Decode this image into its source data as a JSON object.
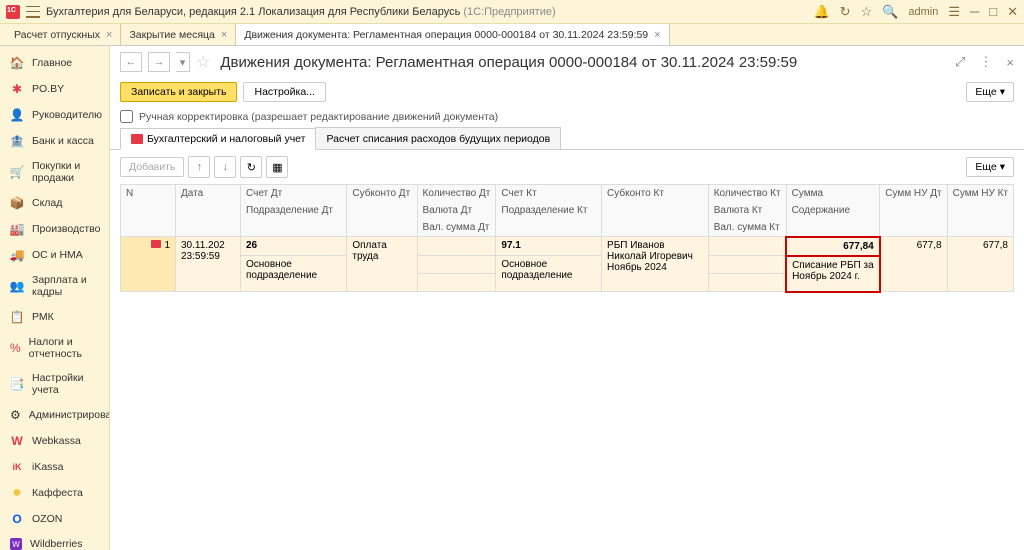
{
  "titlebar": {
    "app_name": "Бухгалтерия для Беларуси, редакция 2.1  Локализация для Республики Беларусь",
    "platform": "(1С:Предприятие)",
    "user": "admin"
  },
  "tabs": [
    {
      "label": "Расчет отпускных"
    },
    {
      "label": "Закрытие месяца"
    },
    {
      "label": "Движения документа: Регламентная операция 0000-000184 от 30.11.2024 23:59:59"
    }
  ],
  "sidebar": {
    "items": [
      {
        "icon": "🏠",
        "label": "Главное",
        "color": "#4a90e2"
      },
      {
        "icon": "✱",
        "label": "PO.BY",
        "color": "#e63946"
      },
      {
        "icon": "👤",
        "label": "Руководителю",
        "color": "#555"
      },
      {
        "icon": "🏦",
        "label": "Банк и касса",
        "color": "#555"
      },
      {
        "icon": "🛒",
        "label": "Покупки и продажи",
        "color": "#555"
      },
      {
        "icon": "📦",
        "label": "Склад",
        "color": "#555"
      },
      {
        "icon": "🏭",
        "label": "Производство",
        "color": "#555"
      },
      {
        "icon": "🚚",
        "label": "ОС и НМА",
        "color": "#555"
      },
      {
        "icon": "👥",
        "label": "Зарплата и кадры",
        "color": "#555"
      },
      {
        "icon": "📋",
        "label": "РМК",
        "color": "#555"
      },
      {
        "icon": "%",
        "label": "Налоги и отчетность",
        "color": "#e63946"
      },
      {
        "icon": "📑",
        "label": "Настройки учета",
        "color": "#555"
      },
      {
        "icon": "⚙",
        "label": "Администрирование",
        "color": "#555"
      },
      {
        "icon": "W",
        "label": "Webkassa",
        "color": "#e63946"
      },
      {
        "icon": "iK",
        "label": "iKassa",
        "color": "#e63946"
      },
      {
        "icon": "●",
        "label": "Каффеста",
        "color": "#f4c542"
      },
      {
        "icon": "O",
        "label": "OZON",
        "color": "#005bff"
      },
      {
        "icon": "W",
        "label": "Wildberries",
        "color": "#7b2cbf"
      }
    ]
  },
  "document": {
    "title": "Движения документа: Регламентная операция 0000-000184 от 30.11.2024 23:59:59",
    "save_close": "Записать и закрыть",
    "settings": "Настройка...",
    "more": "Еще",
    "manual_correction": "Ручная корректировка (разрешает редактирование движений документа)"
  },
  "inner_tabs": [
    {
      "label": "Бухгалтерский и налоговый учет"
    },
    {
      "label": "Расчет списания расходов будущих периодов"
    }
  ],
  "table_toolbar": {
    "add": "Добавить",
    "more": "Еще"
  },
  "table": {
    "headers": {
      "n": "N",
      "date": "Дата",
      "account_dt": "Счет Дт",
      "subconto_dt": "Субконто Дт",
      "qty_dt": "Количество Дт",
      "account_kt": "Счет Кт",
      "subconto_kt": "Субконто Кт",
      "qty_kt": "Количество Кт",
      "sum": "Сумма",
      "sum_nu_dt": "Сумм НУ Дт",
      "sum_nu_kt": "Сумм НУ Кт",
      "division_dt": "Подразделение Дт",
      "currency_dt": "Валюта Дт",
      "division_kt": "Подразделение Кт",
      "currency_kt": "Валюта Кт",
      "content": "Содержание",
      "val_sum_dt": "Вал. сумма Дт",
      "val_sum_kt": "Вал. сумма Кт"
    },
    "rows": [
      {
        "n": "1",
        "date": "30.11.202",
        "time": "23:59:59",
        "account_dt": "26",
        "division_dt": "Основное подразделение",
        "subconto_dt": "Оплата труда",
        "account_kt": "97.1",
        "division_kt": "Основное подразделение",
        "subconto_kt": "РБП Иванов Николай Игоревич Ноябрь 2024",
        "sum": "677,84",
        "content": "Списание РБП за Ноябрь 2024 г.",
        "sum_nu_dt": "677,8",
        "sum_nu_kt": "677,8"
      }
    ]
  }
}
